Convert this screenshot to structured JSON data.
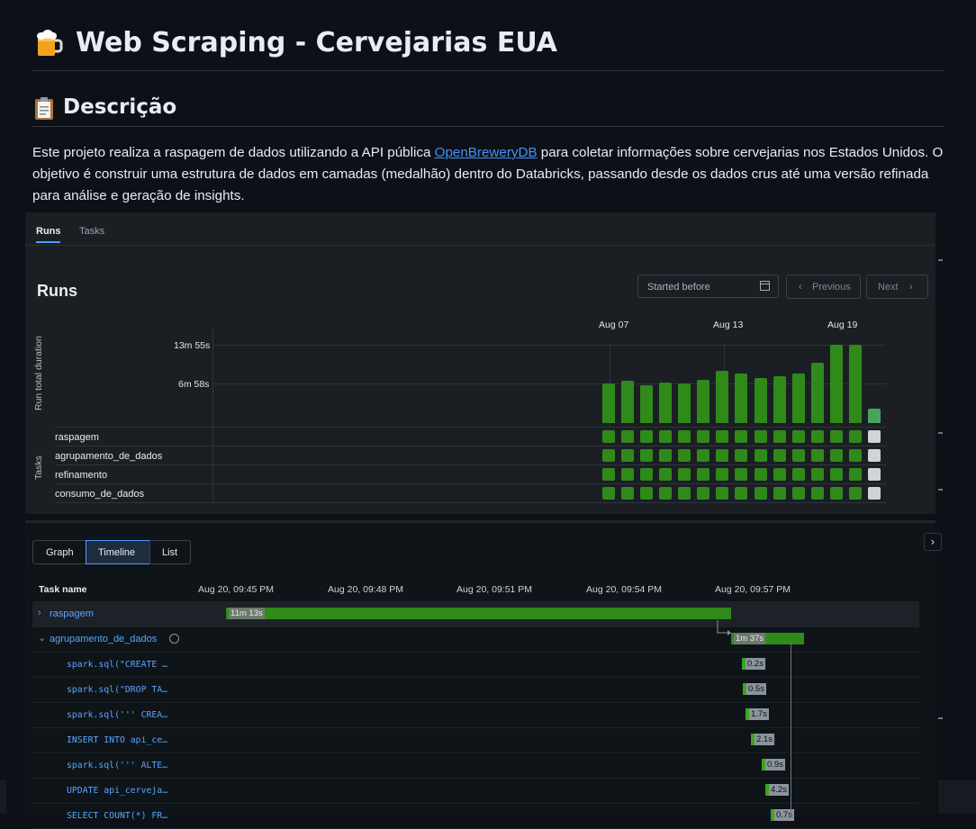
{
  "header": {
    "title": "Web Scraping - Cervejarias EUA",
    "title_icon": "beer-mug-icon"
  },
  "section": {
    "title": "Descrição",
    "icon": "clipboard-icon",
    "text_before": "Este projeto realiza a raspagem de dados utilizando a API pública ",
    "link_text": "OpenBreweryDB",
    "text_after": " para coletar informações sobre cervejarias nos Estados Unidos. O objetivo é construir uma estrutura de dados em camadas (medalhão) dentro do Databricks, passando desde os dados crus até uma versão refinada para análise e geração de insights."
  },
  "runs_panel": {
    "tabs": [
      "Runs",
      "Tasks"
    ],
    "active_tab": "Runs",
    "title": "Runs",
    "date_placeholder": "Started before",
    "prev_label": "Previous",
    "next_label": "Next",
    "y_axis_label": "Run total duration",
    "tasks_axis_label": "Tasks",
    "tasks": [
      "raspagem",
      "agrupamento_de_dados",
      "refinamento",
      "consumo_de_dados"
    ],
    "colors": {
      "success": "#2f8a1a",
      "latest": "#49a35b",
      "pending": "#d0d4d9"
    }
  },
  "chart_data": {
    "type": "bar",
    "title": "Runs",
    "ylabel": "Run total duration",
    "y_ticks": [
      "13m 55s",
      "6m 58s"
    ],
    "y_tick_values_s": [
      835,
      418
    ],
    "x_ticks": [
      "Aug 07",
      "Aug 13",
      "Aug 19"
    ],
    "x_tick_index": [
      0.5,
      6.5,
      12.5
    ],
    "series": [
      {
        "values_s": [
          420,
          450,
          400,
          430,
          420,
          460,
          560,
          530,
          480,
          500,
          530,
          640,
          835,
          835,
          155
        ]
      }
    ],
    "ylim_s": [
      0,
      835
    ]
  },
  "timeline_panel": {
    "views": [
      "Graph",
      "Timeline",
      "List"
    ],
    "active_view": "Timeline",
    "column_header": "Task name",
    "time_ticks": [
      "Aug 20, 09:45 PM",
      "Aug 20, 09:48 PM",
      "Aug 20, 09:51 PM",
      "Aug 20, 09:54 PM",
      "Aug 20, 09:57 PM"
    ],
    "rows": [
      {
        "name": "raspagem",
        "duration": "11m 13s",
        "expand": "›"
      },
      {
        "name": "agrupamento_de_dados",
        "duration": "1m 37s",
        "expand": "⌄"
      },
      {
        "name": "spark.sql(\"CREATE …",
        "duration": "0.2s"
      },
      {
        "name": "spark.sql(\"DROP TA…",
        "duration": "0.5s"
      },
      {
        "name": "spark.sql(''' CREA…",
        "duration": "1.7s"
      },
      {
        "name": "INSERT INTO api_ce…",
        "duration": "2.1s"
      },
      {
        "name": "spark.sql(''' ALTE…",
        "duration": "0.9s"
      },
      {
        "name": "UPDATE api_cerveja…",
        "duration": "4.2s"
      },
      {
        "name": "SELECT COUNT(*) FR…",
        "duration": "0.7s"
      }
    ]
  }
}
